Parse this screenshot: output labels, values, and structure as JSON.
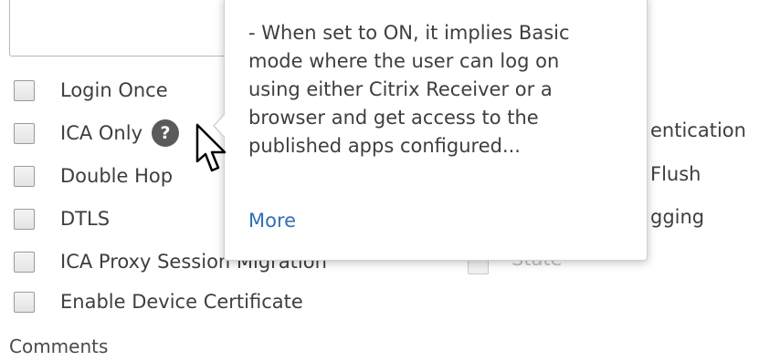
{
  "checkboxes_left": [
    {
      "label": "Login Once",
      "checked": false
    },
    {
      "label": "ICA Only",
      "checked": false
    },
    {
      "label": "Double Hop",
      "checked": false
    },
    {
      "label": "DTLS",
      "checked": false
    },
    {
      "label": "ICA Proxy Session Migration",
      "checked": false
    },
    {
      "label": "Enable Device Certificate",
      "checked": false
    }
  ],
  "checkboxes_right_partial": [
    {
      "label": "entication"
    },
    {
      "label": "Flush"
    },
    {
      "label": "gging"
    },
    {
      "label": "State"
    }
  ],
  "help_icon_glyph": "?",
  "tooltip": {
    "text": "- When set to ON, it implies Basic\nmode where the user can log on\nusing either Citrix Receiver or a\nbrowser and get access to the\npublished apps configured...",
    "link": "More"
  },
  "comments_label": "Comments",
  "colors": {
    "link": "#2f6fb8",
    "help_icon_bg": "#5a5a5a"
  }
}
